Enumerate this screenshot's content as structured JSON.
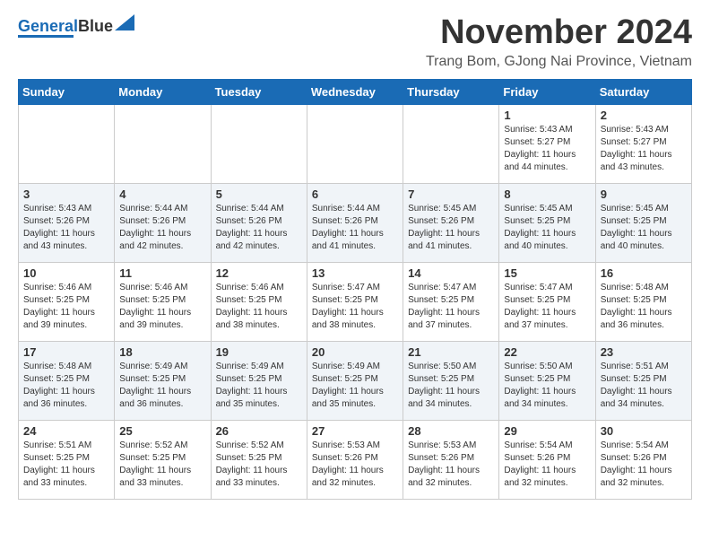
{
  "logo": {
    "part1": "General",
    "part2": "Blue"
  },
  "header": {
    "month": "November 2024",
    "location": "Trang Bom, GJong Nai Province, Vietnam"
  },
  "days_header": [
    "Sunday",
    "Monday",
    "Tuesday",
    "Wednesday",
    "Thursday",
    "Friday",
    "Saturday"
  ],
  "weeks": [
    [
      {
        "day": "",
        "info": ""
      },
      {
        "day": "",
        "info": ""
      },
      {
        "day": "",
        "info": ""
      },
      {
        "day": "",
        "info": ""
      },
      {
        "day": "",
        "info": ""
      },
      {
        "day": "1",
        "info": "Sunrise: 5:43 AM\nSunset: 5:27 PM\nDaylight: 11 hours\nand 44 minutes."
      },
      {
        "day": "2",
        "info": "Sunrise: 5:43 AM\nSunset: 5:27 PM\nDaylight: 11 hours\nand 43 minutes."
      }
    ],
    [
      {
        "day": "3",
        "info": "Sunrise: 5:43 AM\nSunset: 5:26 PM\nDaylight: 11 hours\nand 43 minutes."
      },
      {
        "day": "4",
        "info": "Sunrise: 5:44 AM\nSunset: 5:26 PM\nDaylight: 11 hours\nand 42 minutes."
      },
      {
        "day": "5",
        "info": "Sunrise: 5:44 AM\nSunset: 5:26 PM\nDaylight: 11 hours\nand 42 minutes."
      },
      {
        "day": "6",
        "info": "Sunrise: 5:44 AM\nSunset: 5:26 PM\nDaylight: 11 hours\nand 41 minutes."
      },
      {
        "day": "7",
        "info": "Sunrise: 5:45 AM\nSunset: 5:26 PM\nDaylight: 11 hours\nand 41 minutes."
      },
      {
        "day": "8",
        "info": "Sunrise: 5:45 AM\nSunset: 5:25 PM\nDaylight: 11 hours\nand 40 minutes."
      },
      {
        "day": "9",
        "info": "Sunrise: 5:45 AM\nSunset: 5:25 PM\nDaylight: 11 hours\nand 40 minutes."
      }
    ],
    [
      {
        "day": "10",
        "info": "Sunrise: 5:46 AM\nSunset: 5:25 PM\nDaylight: 11 hours\nand 39 minutes."
      },
      {
        "day": "11",
        "info": "Sunrise: 5:46 AM\nSunset: 5:25 PM\nDaylight: 11 hours\nand 39 minutes."
      },
      {
        "day": "12",
        "info": "Sunrise: 5:46 AM\nSunset: 5:25 PM\nDaylight: 11 hours\nand 38 minutes."
      },
      {
        "day": "13",
        "info": "Sunrise: 5:47 AM\nSunset: 5:25 PM\nDaylight: 11 hours\nand 38 minutes."
      },
      {
        "day": "14",
        "info": "Sunrise: 5:47 AM\nSunset: 5:25 PM\nDaylight: 11 hours\nand 37 minutes."
      },
      {
        "day": "15",
        "info": "Sunrise: 5:47 AM\nSunset: 5:25 PM\nDaylight: 11 hours\nand 37 minutes."
      },
      {
        "day": "16",
        "info": "Sunrise: 5:48 AM\nSunset: 5:25 PM\nDaylight: 11 hours\nand 36 minutes."
      }
    ],
    [
      {
        "day": "17",
        "info": "Sunrise: 5:48 AM\nSunset: 5:25 PM\nDaylight: 11 hours\nand 36 minutes."
      },
      {
        "day": "18",
        "info": "Sunrise: 5:49 AM\nSunset: 5:25 PM\nDaylight: 11 hours\nand 36 minutes."
      },
      {
        "day": "19",
        "info": "Sunrise: 5:49 AM\nSunset: 5:25 PM\nDaylight: 11 hours\nand 35 minutes."
      },
      {
        "day": "20",
        "info": "Sunrise: 5:49 AM\nSunset: 5:25 PM\nDaylight: 11 hours\nand 35 minutes."
      },
      {
        "day": "21",
        "info": "Sunrise: 5:50 AM\nSunset: 5:25 PM\nDaylight: 11 hours\nand 34 minutes."
      },
      {
        "day": "22",
        "info": "Sunrise: 5:50 AM\nSunset: 5:25 PM\nDaylight: 11 hours\nand 34 minutes."
      },
      {
        "day": "23",
        "info": "Sunrise: 5:51 AM\nSunset: 5:25 PM\nDaylight: 11 hours\nand 34 minutes."
      }
    ],
    [
      {
        "day": "24",
        "info": "Sunrise: 5:51 AM\nSunset: 5:25 PM\nDaylight: 11 hours\nand 33 minutes."
      },
      {
        "day": "25",
        "info": "Sunrise: 5:52 AM\nSunset: 5:25 PM\nDaylight: 11 hours\nand 33 minutes."
      },
      {
        "day": "26",
        "info": "Sunrise: 5:52 AM\nSunset: 5:25 PM\nDaylight: 11 hours\nand 33 minutes."
      },
      {
        "day": "27",
        "info": "Sunrise: 5:53 AM\nSunset: 5:26 PM\nDaylight: 11 hours\nand 32 minutes."
      },
      {
        "day": "28",
        "info": "Sunrise: 5:53 AM\nSunset: 5:26 PM\nDaylight: 11 hours\nand 32 minutes."
      },
      {
        "day": "29",
        "info": "Sunrise: 5:54 AM\nSunset: 5:26 PM\nDaylight: 11 hours\nand 32 minutes."
      },
      {
        "day": "30",
        "info": "Sunrise: 5:54 AM\nSunset: 5:26 PM\nDaylight: 11 hours\nand 32 minutes."
      }
    ]
  ]
}
